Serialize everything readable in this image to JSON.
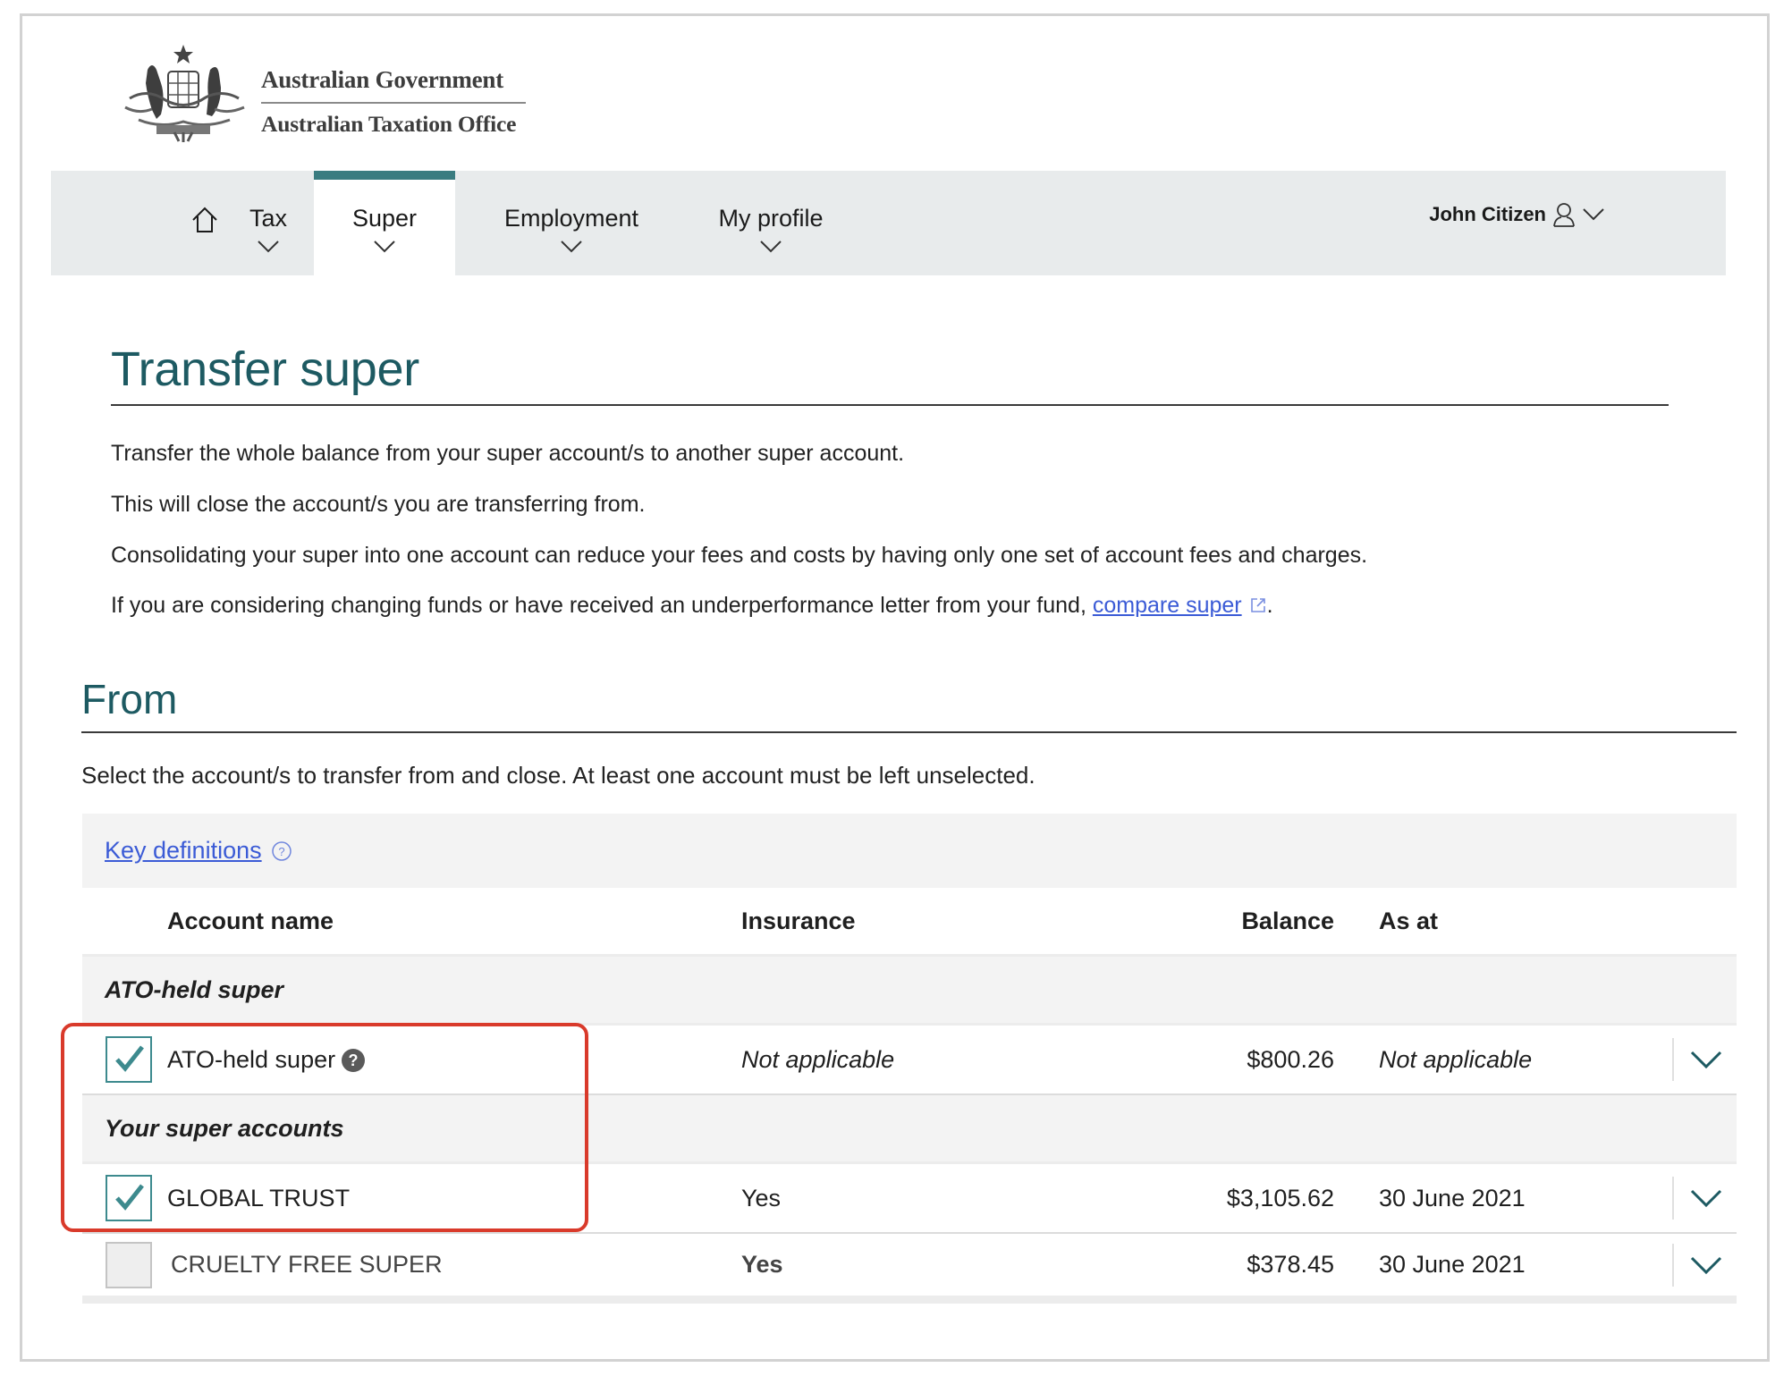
{
  "header": {
    "gov_line1": "Australian Government",
    "gov_line2": "Australian Taxation Office",
    "logo_icon": "coat-of-arms"
  },
  "nav": {
    "home_icon": "home-icon",
    "items": [
      {
        "label": "Tax",
        "active": false
      },
      {
        "label": "Super",
        "active": true
      },
      {
        "label": "Employment",
        "active": false
      },
      {
        "label": "My profile",
        "active": false
      }
    ],
    "user": {
      "name": "John Citizen",
      "icon": "user-icon"
    },
    "accent_color": "#3a7c80"
  },
  "page": {
    "title": "Transfer super",
    "paragraphs": [
      "Transfer the whole balance from your super account/s to another super account.",
      "This will close the account/s you are transferring from.",
      "Consolidating your super into one account can reduce your fees and costs by having only one set of account fees and charges."
    ],
    "compare_para_prefix": "If you are considering changing funds or have received an underperformance letter from your fund, ",
    "compare_link": "compare super",
    "compare_para_suffix": "."
  },
  "from": {
    "title": "From",
    "instruction": "Select the account/s to transfer from and close. At least one account must be left unselected.",
    "key_definitions": "Key definitions",
    "columns": {
      "account_name": "Account name",
      "insurance": "Insurance",
      "balance": "Balance",
      "as_at": "As at"
    },
    "groups": [
      {
        "label": "ATO-held super",
        "accounts": [
          {
            "name": "ATO-held super",
            "checked": true,
            "help": true,
            "insurance": "Not applicable",
            "balance": "$800.26",
            "as_at": "Not applicable"
          }
        ]
      },
      {
        "label": "Your super accounts",
        "accounts": [
          {
            "name": "GLOBAL TRUST",
            "checked": true,
            "insurance": "Yes",
            "balance": "$3,105.62",
            "as_at": "30 June 2021"
          },
          {
            "name": "CRUELTY FREE SUPER",
            "checked": false,
            "insurance": "Yes",
            "balance": "$378.45",
            "as_at": "30 June 2021"
          }
        ]
      }
    ]
  },
  "annotation": {
    "highlight_color": "#d93a2b"
  }
}
